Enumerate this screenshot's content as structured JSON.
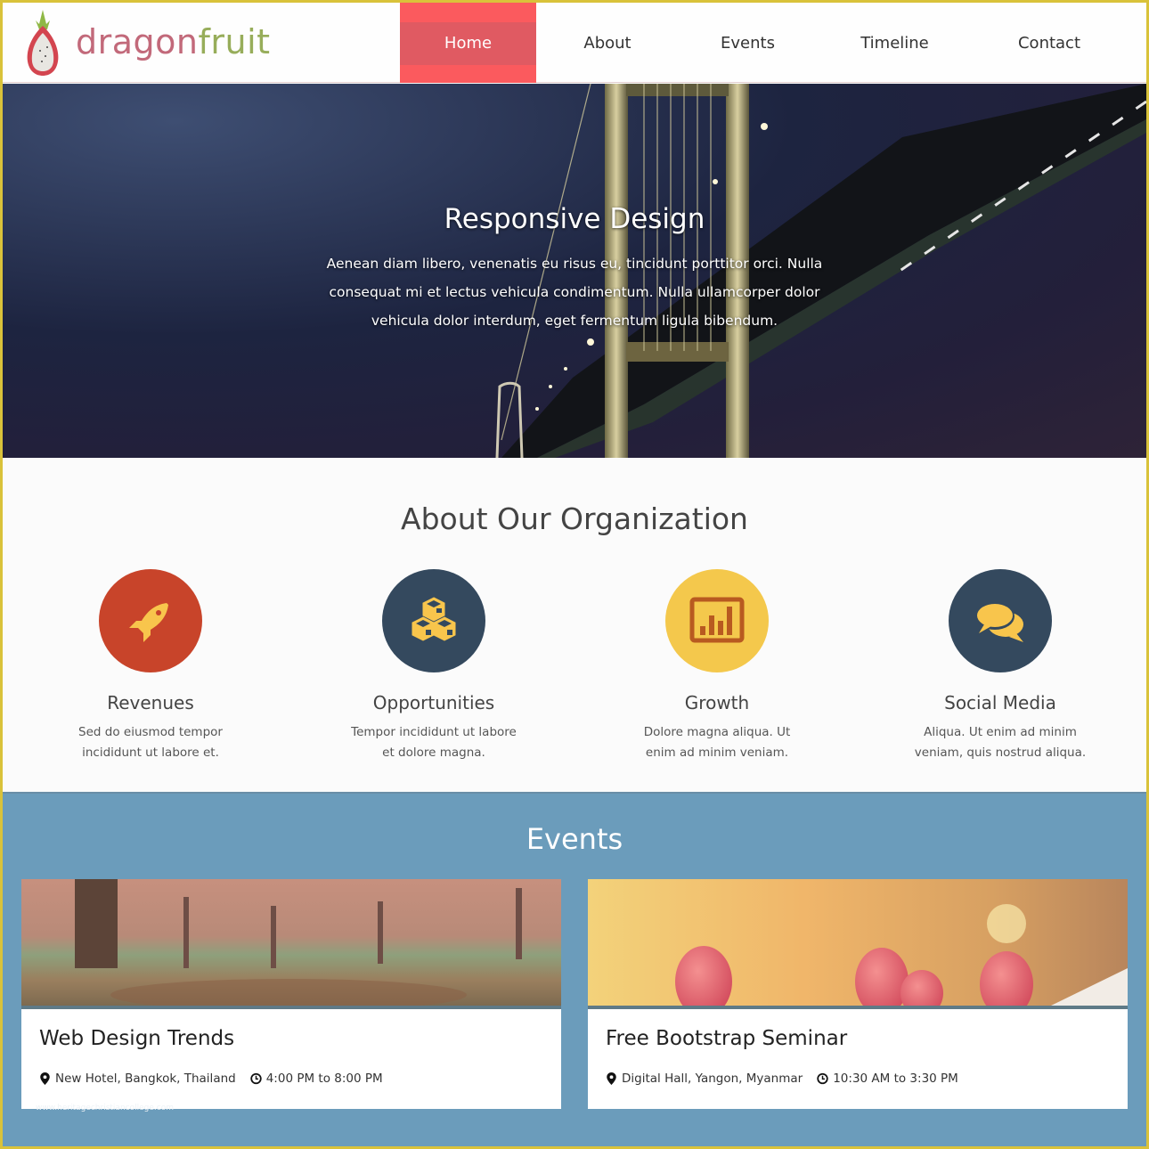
{
  "brand": {
    "name_part1": "dragon",
    "name_part2": "fruit"
  },
  "nav": {
    "items": [
      {
        "label": "Home",
        "active": true
      },
      {
        "label": "About",
        "active": false
      },
      {
        "label": "Events",
        "active": false
      },
      {
        "label": "Timeline",
        "active": false
      },
      {
        "label": "Contact",
        "active": false
      }
    ]
  },
  "hero": {
    "title": "Responsive Design",
    "text": "Aenean diam libero, venenatis eu risus eu, tincidunt porttitor orci. Nulla consequat mi et lectus vehicula condimentum. Nulla ullamcorper dolor vehicula dolor interdum, eget fermentum ligula bibendum."
  },
  "about": {
    "title": "About Our Organization",
    "features": [
      {
        "icon": "rocket-icon",
        "title": "Revenues",
        "text": "Sed do eiusmod tempor incididunt ut labore et.",
        "color": "#c8442a"
      },
      {
        "icon": "cubes-icon",
        "title": "Opportunities",
        "text": "Tempor incididunt ut labore et dolore magna.",
        "color": "#34495e"
      },
      {
        "icon": "bar-chart-icon",
        "title": "Growth",
        "text": "Dolore magna aliqua. Ut enim ad minim veniam.",
        "color": "#f4c84c"
      },
      {
        "icon": "chat-bubbles-icon",
        "title": "Social Media",
        "text": "Aliqua. Ut enim ad minim veniam, quis nostrud aliqua.",
        "color": "#34495e"
      }
    ]
  },
  "events": {
    "title": "Events",
    "items": [
      {
        "title": "Web Design Trends",
        "location": "New Hotel, Bangkok, Thailand",
        "time": "4:00 PM to 8:00 PM"
      },
      {
        "title": "Free Bootstrap Seminar",
        "location": "Digital Hall, Yangon, Myanmar",
        "time": "10:30 AM to 3:30 PM"
      }
    ]
  },
  "watermark": "www.heritagechristiancollege.com",
  "colors": {
    "accent": "#fb5a5e",
    "events_bg": "#6b9cbb",
    "frame": "#d9c23a",
    "icon_fill": "#f4c84c"
  }
}
